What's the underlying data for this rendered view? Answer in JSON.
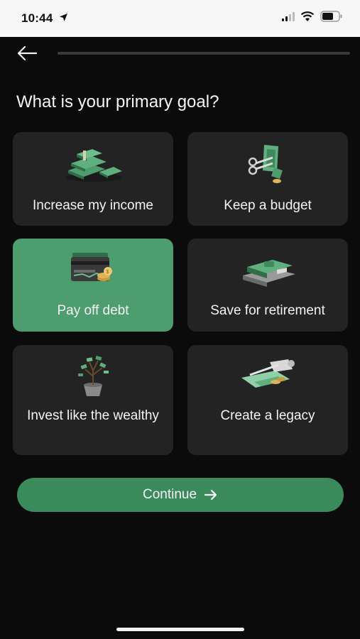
{
  "status_bar": {
    "time": "10:44",
    "location_icon": "location-arrow-icon",
    "signal_icon": "signal-icon",
    "wifi_icon": "wifi-icon",
    "battery_icon": "battery-icon"
  },
  "nav": {
    "back_icon": "back-arrow-icon",
    "progress_percent": 0
  },
  "question": "What is your primary goal?",
  "options": [
    {
      "label": "Increase my income",
      "icon": "cash-stack-icon",
      "selected": false
    },
    {
      "label": "Keep a budget",
      "icon": "scissors-cash-icon",
      "selected": false
    },
    {
      "label": "Pay off debt",
      "icon": "credit-card-coins-icon",
      "selected": true
    },
    {
      "label": "Save for retirement",
      "icon": "book-stack-icon",
      "selected": false
    },
    {
      "label": "Invest like the wealthy",
      "icon": "money-tree-icon",
      "selected": false
    },
    {
      "label": "Create a legacy",
      "icon": "scroll-pen-icon",
      "selected": false
    }
  ],
  "continue_button": {
    "label": "Continue",
    "icon": "arrow-right-icon"
  },
  "colors": {
    "accent": "#4d9d70",
    "button": "#3b8a5c",
    "card": "#232323",
    "background": "#0b0b0b"
  }
}
